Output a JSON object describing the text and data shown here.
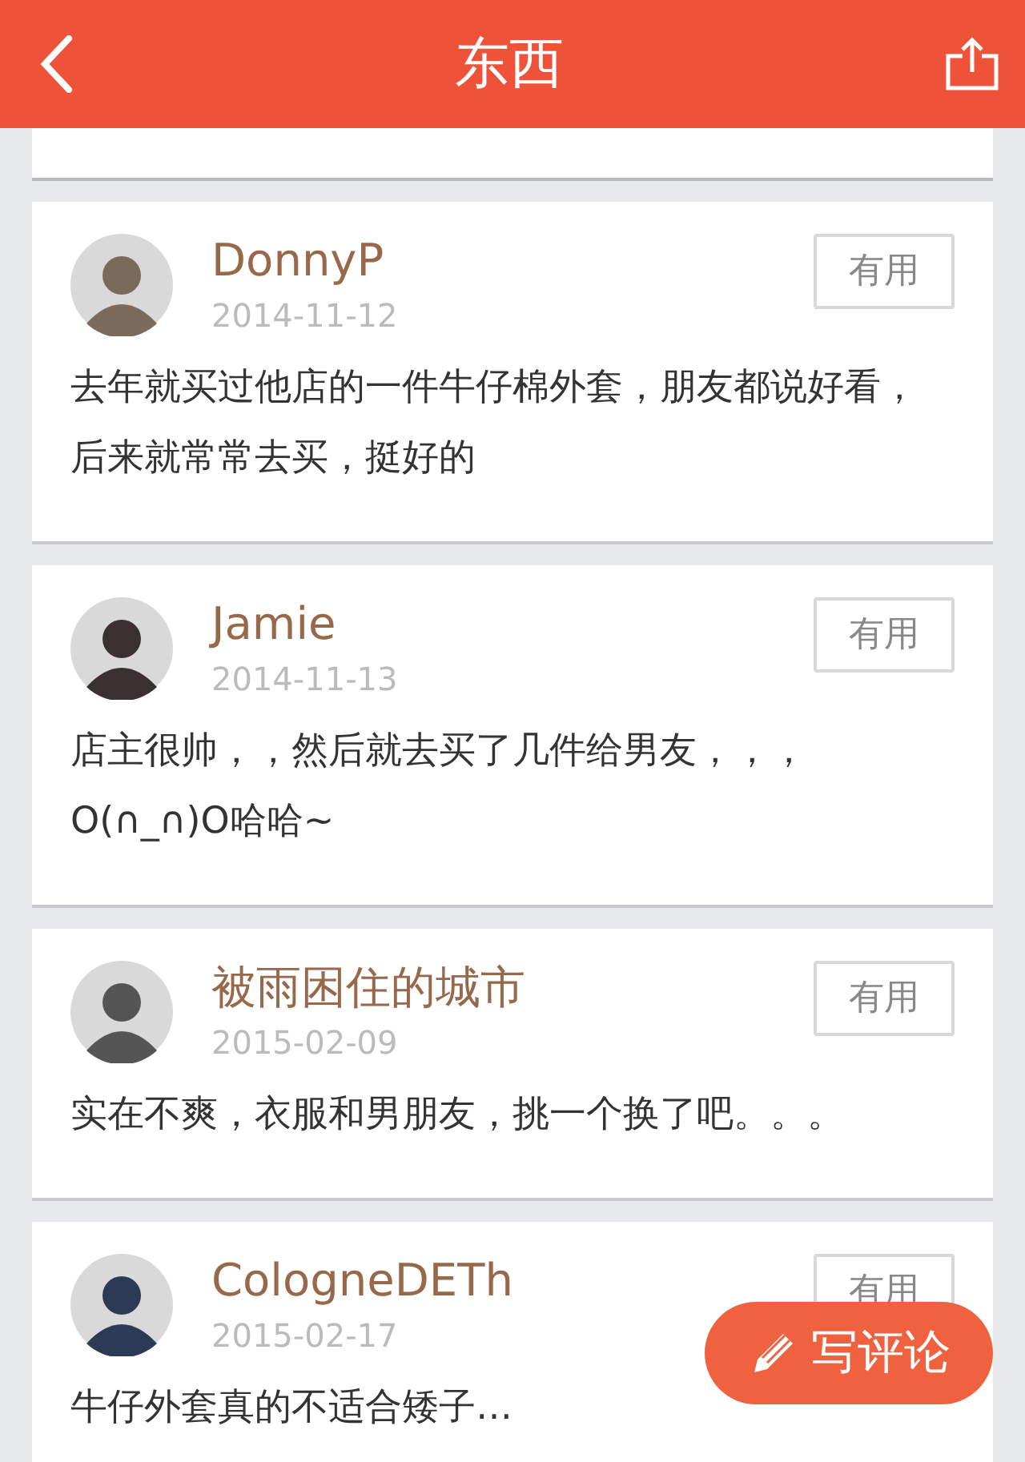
{
  "header": {
    "title": "东西"
  },
  "reviews": [
    {
      "user": "DonnyP",
      "date": "2014-11-12",
      "button": "有用",
      "text": "去年就买过他店的一件牛仔棉外套，朋友都说好看，后来就常常去买，挺好的"
    },
    {
      "user": "Jamie",
      "date": "2014-11-13",
      "button": "有用",
      "text": "店主很帅，，然后就去买了几件给男友，，，O(∩_∩)O哈哈~"
    },
    {
      "user": "被雨困住的城市",
      "date": "2015-02-09",
      "button": "有用",
      "text": "实在不爽，衣服和男朋友，挑一个换了吧。。。"
    },
    {
      "user": "CologneDETh",
      "date": "2015-02-17",
      "button": "有用",
      "text": "牛仔外套真的不适合矮子…"
    }
  ],
  "fab": {
    "label": "写评论"
  }
}
